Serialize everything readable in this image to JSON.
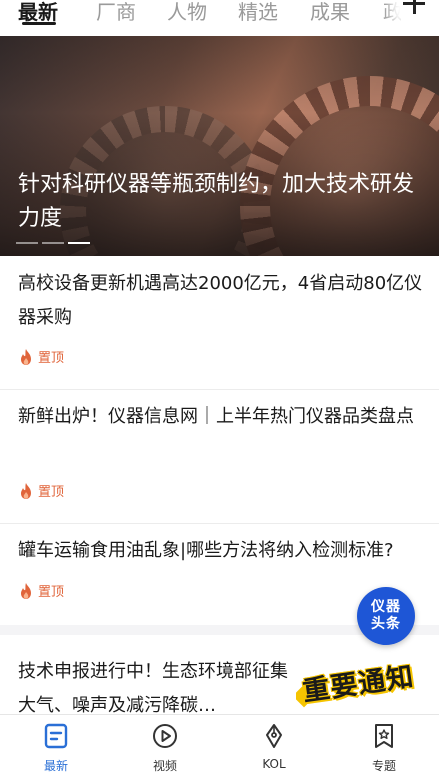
{
  "tabs": [
    {
      "label": "最新",
      "active": true
    },
    {
      "label": "厂商",
      "active": false
    },
    {
      "label": "人物",
      "active": false
    },
    {
      "label": "精选",
      "active": false
    },
    {
      "label": "成果",
      "active": false
    },
    {
      "label": "政",
      "active": false
    }
  ],
  "banner": {
    "title": "针对科研仪器等瓶颈制约，加大技术研发力度",
    "slide_count": 3,
    "active_slide": 3
  },
  "news": [
    {
      "title": "高校设备更新机遇高达2000亿元，4省启动80亿仪器采购",
      "pin_label": "置顶"
    },
    {
      "title": "新鲜出炉！仪器信息网｜上半年热门仪器品类盘点",
      "pin_label": "置顶"
    },
    {
      "title": "罐车运输食用油乱象|哪些方法将纳入检测标准?",
      "pin_label": "置顶"
    },
    {
      "title": "技术申报进行中！生态环境部征集大气、噪声及减污降碳…"
    }
  ],
  "promo": {
    "text": "重要通知"
  },
  "fab": {
    "line1": "仪器",
    "line2": "头条"
  },
  "bottom_nav": [
    {
      "label": "最新",
      "icon": "document-icon",
      "active": true
    },
    {
      "label": "视频",
      "icon": "play-icon",
      "active": false
    },
    {
      "label": "KOL",
      "icon": "pen-nib-icon",
      "active": false
    },
    {
      "label": "专题",
      "icon": "bookmark-star-icon",
      "active": false
    }
  ],
  "colors": {
    "accent": "#2a6fd6",
    "pin": "#e0643a",
    "fab": "#1e56d6"
  }
}
